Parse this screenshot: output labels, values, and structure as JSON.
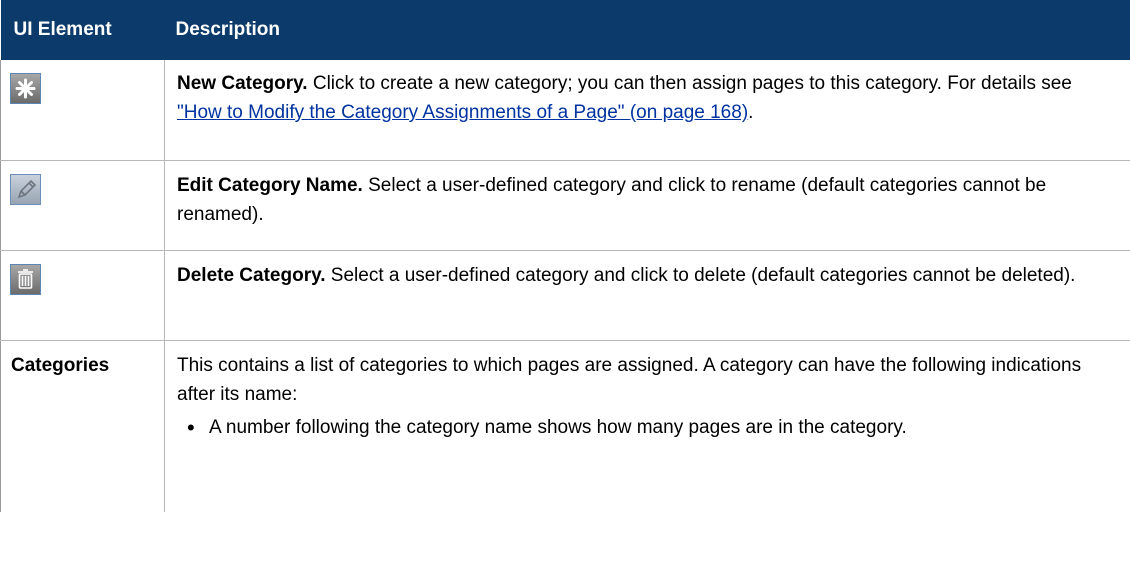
{
  "table": {
    "headers": [
      "UI Element",
      "Description"
    ],
    "rows": [
      {
        "icon": "new-category-icon",
        "lead": "New Category.",
        "text": " Click to create a new category; you can then assign pages to this category. For details see ",
        "link": "\"How to Modify the Category Assignments of a Page\" (on page 168)",
        "after": "."
      },
      {
        "icon": "edit-pencil-icon",
        "lead": "Edit Category Name.",
        "text": " Select a user-defined category and click to rename (default categories cannot be renamed)."
      },
      {
        "icon": "trash-icon",
        "lead": "Delete Category.",
        "text": " Select a user-defined category and click to delete (default categories cannot be deleted)."
      },
      {
        "label": "Categories",
        "text": "This contains a list of categories to which pages are assigned. A category can have the following indications after its name:",
        "bullets": [
          "A number following the category name shows how many pages are in the category."
        ]
      }
    ]
  },
  "colors": {
    "header_bg": "#0b3a6b",
    "header_text": "#ffffff",
    "link": "#0033a0"
  }
}
